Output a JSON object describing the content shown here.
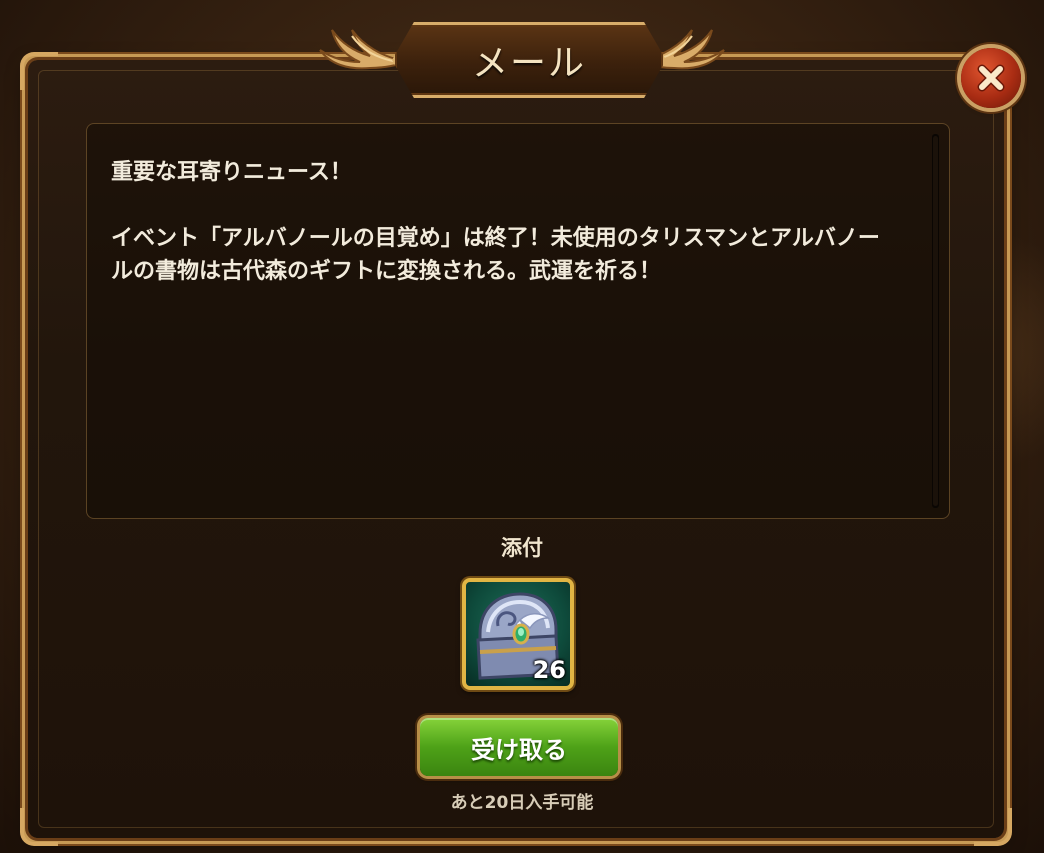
{
  "dialog": {
    "title": "メール",
    "close_icon": "close-x-icon"
  },
  "message": {
    "body": "重要な耳寄りニュース！\n\nイベント「アルバノールの目覚め」は終了！未使用のタリスマンとアルバノールの書物は古代森のギフトに変換される。武運を祈る！"
  },
  "attachment": {
    "label": "添付",
    "item_icon": "treasure-chest-icon",
    "item_count": "26"
  },
  "claim": {
    "button_label": "受け取る",
    "expiry_text": "あと20日入手可能"
  },
  "colors": {
    "frame_gold": "#c79a55",
    "panel_bg": "#22160c",
    "claim_green": "#4ea218",
    "close_red": "#a92c13",
    "slot_gold": "#e1b544"
  }
}
